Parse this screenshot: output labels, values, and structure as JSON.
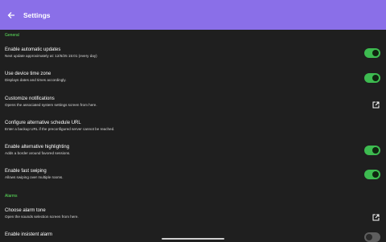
{
  "appbar": {
    "title": "Settings",
    "back_icon": "back-arrow-icon",
    "color": "#8a6fe8"
  },
  "sections": {
    "general": "General",
    "alarms": "Alarms"
  },
  "rows": {
    "auto_updates": {
      "title": "Enable automatic updates",
      "subtitle": "Next update approximately at: 12/6/25 15:01 (every day)",
      "enabled": true
    },
    "device_tz": {
      "title": "Use device time zone",
      "subtitle": "Displays dates and times accordingly.",
      "enabled": true
    },
    "notifications": {
      "title": "Customize notifications",
      "subtitle": "Opens the associated system settings screen from here.",
      "icon": "open-external-icon"
    },
    "schedule_url": {
      "title": "Configure alternative schedule URL",
      "subtitle": "Enter a backup URL if the preconfigured server cannot be reached."
    },
    "highlighting": {
      "title": "Enable alternative highlighting",
      "subtitle": "Adds a border around favored sessions.",
      "enabled": true
    },
    "fast_swiping": {
      "title": "Enable fast swiping",
      "subtitle": "Allows swiping over multiple rooms.",
      "enabled": true
    },
    "alarm_tone": {
      "title": "Choose alarm tone",
      "subtitle": "Open the sounds selection screen from here.",
      "icon": "open-external-icon"
    },
    "insistent": {
      "title": "Enable insistent alarm",
      "enabled": false
    }
  },
  "colors": {
    "background": "#1f1f1f",
    "accent_green": "#5ce65c",
    "toggle_on": "#3dbb50",
    "toggle_off": "#5e5e5e"
  }
}
